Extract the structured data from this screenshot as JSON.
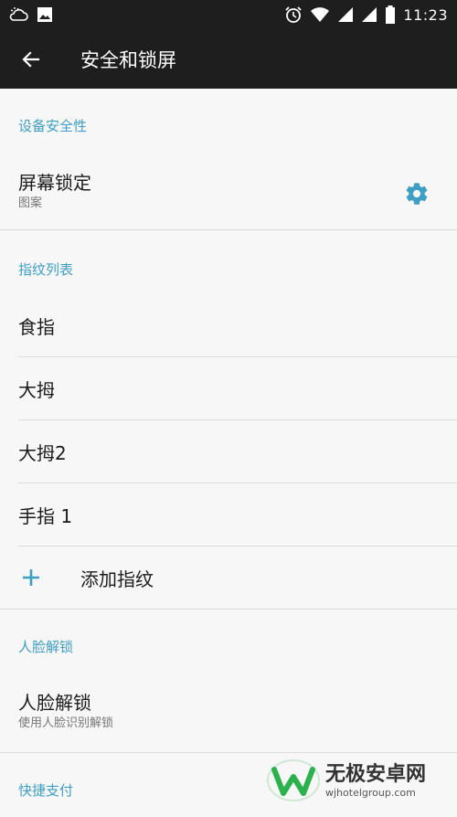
{
  "status_bar": {
    "time": "11:23",
    "icons": [
      "weather-cloud-icon",
      "image-icon",
      "alarm-icon",
      "wifi-icon",
      "signal-icon",
      "signal-icon",
      "battery-icon"
    ]
  },
  "app_bar": {
    "title": "安全和锁屏"
  },
  "sections": {
    "device_security": {
      "header": "设备安全性",
      "screen_lock": {
        "title": "屏幕锁定",
        "summary": "图案"
      }
    },
    "fingerprints": {
      "header": "指纹列表",
      "items": [
        "食指",
        "大拇",
        "大拇2",
        "手指 1"
      ],
      "add_label": "添加指纹"
    },
    "face_unlock": {
      "header": "人脸解锁",
      "item": {
        "title": "人脸解锁",
        "summary": "使用人脸识别解锁"
      }
    },
    "quick_pay": {
      "header": "快捷支付"
    }
  },
  "watermark": {
    "line1": "无极安卓网",
    "line2": "wjhotelgroup.com"
  },
  "colors": {
    "accent": "#3e9ec4",
    "appbar": "#1e1e1e",
    "background": "#f7f7f7",
    "watermark_green": "#2bb24c"
  }
}
